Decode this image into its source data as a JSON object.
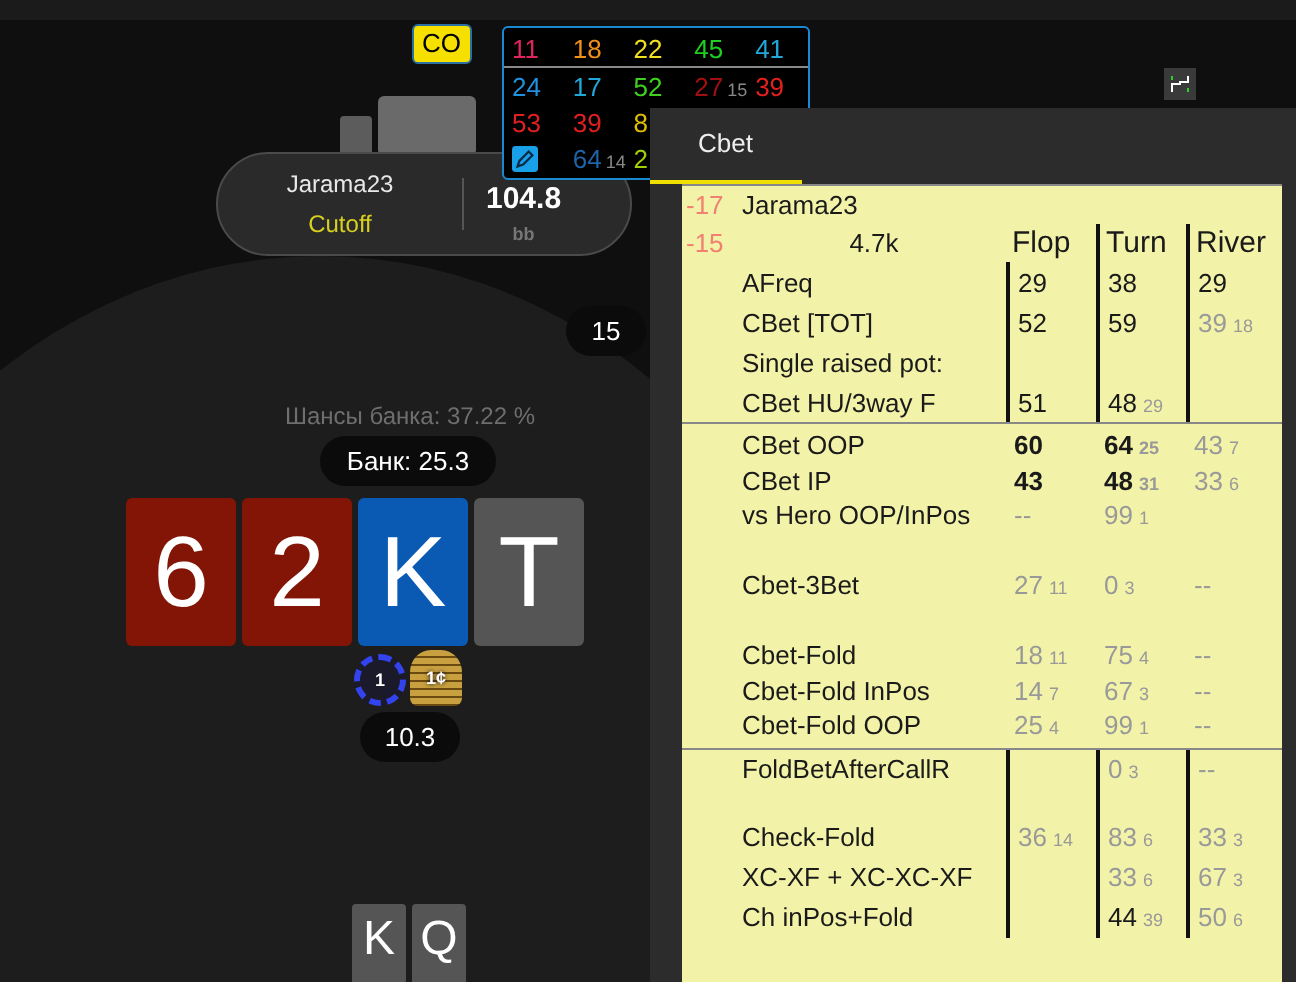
{
  "hud": {
    "rows": [
      [
        {
          "kind": "stat",
          "text": "11",
          "color": "#e0245e"
        },
        {
          "kind": "stat",
          "text": "18",
          "color": "#f0901a"
        },
        {
          "kind": "stat",
          "text": "22",
          "color": "#f0e020"
        },
        {
          "kind": "stat",
          "text": "45",
          "color": "#20d020"
        },
        {
          "kind": "stat",
          "text": "41",
          "color": "#20a8d8"
        }
      ],
      [
        {
          "kind": "stat",
          "text": "24",
          "color": "#2090e0"
        },
        {
          "kind": "stat",
          "text": "17",
          "color": "#20a8d8"
        },
        {
          "kind": "stat",
          "text": "52",
          "color": "#40d020"
        },
        {
          "kind": "stat",
          "text": "27",
          "sub": "15",
          "color": "#a01010"
        },
        {
          "kind": "stat",
          "text": "39",
          "color": "#e02020"
        }
      ],
      [
        {
          "kind": "stat",
          "text": "53",
          "color": "#e02020"
        },
        {
          "kind": "stat",
          "text": "39",
          "color": "#e02020"
        },
        {
          "kind": "stat",
          "text": "8",
          "color": "#e0c000"
        }
      ],
      [
        {
          "kind": "edit"
        },
        {
          "kind": "stat",
          "text": "64",
          "sub": "14",
          "color": "#1f63a8"
        },
        {
          "kind": "stat",
          "text": "2",
          "color": "#a0d000"
        }
      ]
    ]
  },
  "seat": {
    "badge": "CO",
    "name": "Jarama23",
    "position": "Cutoff",
    "stack": "104.8",
    "unit": "bb",
    "bet": "15"
  },
  "pot": {
    "odds": "Шансы банка: 37.22 %",
    "total": "Банк: 25.3",
    "chips": [
      {
        "label": "1",
        "kind": "round"
      },
      {
        "label": "1¢",
        "kind": "stack"
      }
    ],
    "amount": "10.3"
  },
  "board": [
    {
      "rank": "6",
      "color": "#831507"
    },
    {
      "rank": "2",
      "color": "#831507"
    },
    {
      "rank": "K",
      "color": "#0a5ab4"
    },
    {
      "rank": "T",
      "color": "#555555"
    }
  ],
  "hero_cards": [
    {
      "rank": "K"
    },
    {
      "rank": "Q"
    }
  ],
  "stats_panel": {
    "tabs": [
      {
        "label": "Cbet",
        "selected": true
      }
    ],
    "header": {
      "score_1": "-17",
      "player": "Jarama23",
      "score_2": "-15",
      "hands": "4.7k",
      "columns": [
        "Flop",
        "Turn",
        "River"
      ]
    },
    "sections": [
      {
        "kind": "lined",
        "rows": [
          {
            "kind": "stat",
            "label": "AFreq",
            "flop": {
              "v": "29",
              "bold": false,
              "muted": false
            },
            "turn": {
              "v": "38",
              "bold": false,
              "muted": false
            },
            "river": {
              "v": "29",
              "bold": false,
              "muted": false
            }
          },
          {
            "kind": "stat",
            "label": "CBet [TOT]",
            "flop": {
              "v": "52",
              "bold": false,
              "muted": false
            },
            "turn": {
              "v": "59",
              "bold": false,
              "muted": false
            },
            "river": {
              "v": "39",
              "n": "18",
              "bold": false,
              "muted": true
            }
          },
          {
            "kind": "stat",
            "label": "Single raised pot:"
          },
          {
            "kind": "stat",
            "label": "CBet HU/3way F",
            "flop": {
              "v": "51",
              "bold": false,
              "muted": false
            },
            "turn": {
              "v": "48",
              "n": "29",
              "bold": false,
              "muted": false
            }
          }
        ]
      },
      {
        "kind": "boxed",
        "rows": [
          {
            "kind": "stat",
            "label": "CBet OOP",
            "flop": {
              "v": "60",
              "bold": true,
              "muted": false
            },
            "turn": {
              "v": "64",
              "n": "25",
              "bold": true,
              "muted": false
            },
            "river": {
              "v": "43",
              "n": "7",
              "bold": false,
              "muted": true
            }
          },
          {
            "kind": "stat",
            "label": "CBet IP",
            "flop": {
              "v": "43",
              "bold": true,
              "muted": false
            },
            "turn": {
              "v": "48",
              "n": "31",
              "bold": true,
              "muted": false
            },
            "river": {
              "v": "33",
              "n": "6",
              "bold": false,
              "muted": true
            }
          },
          {
            "kind": "stat",
            "label": "vs Hero OOP/InPos",
            "flop": {
              "v": "--",
              "bold": false,
              "muted": true
            },
            "turn": {
              "v": "99",
              "n": "1",
              "bold": false,
              "muted": true
            }
          },
          {
            "kind": "gap"
          },
          {
            "kind": "stat",
            "label": "Cbet-3Bet",
            "flop": {
              "v": "27",
              "n": "11",
              "bold": false,
              "muted": true
            },
            "turn": {
              "v": "0",
              "n": "3",
              "bold": false,
              "muted": true
            },
            "river": {
              "v": "--",
              "bold": false,
              "muted": true
            }
          },
          {
            "kind": "gap"
          },
          {
            "kind": "stat",
            "label": "Cbet-Fold",
            "flop": {
              "v": "18",
              "n": "11",
              "bold": false,
              "muted": true
            },
            "turn": {
              "v": "75",
              "n": "4",
              "bold": false,
              "muted": true
            },
            "river": {
              "v": "--",
              "bold": false,
              "muted": true
            }
          },
          {
            "kind": "stat",
            "label": "Cbet-Fold InPos",
            "flop": {
              "v": "14",
              "n": "7",
              "bold": false,
              "muted": true
            },
            "turn": {
              "v": "67",
              "n": "3",
              "bold": false,
              "muted": true
            },
            "river": {
              "v": "--",
              "bold": false,
              "muted": true
            }
          },
          {
            "kind": "stat",
            "label": "Cbet-Fold OOP",
            "flop": {
              "v": "25",
              "n": "4",
              "bold": false,
              "muted": true
            },
            "turn": {
              "v": "99",
              "n": "1",
              "bold": false,
              "muted": true
            },
            "river": {
              "v": "--",
              "bold": false,
              "muted": true
            }
          }
        ]
      },
      {
        "kind": "lined",
        "rows": [
          {
            "kind": "stat",
            "label": "FoldBetAfterCallR",
            "turn": {
              "v": "0",
              "n": "3",
              "bold": false,
              "muted": true
            },
            "river": {
              "v": "--",
              "bold": false,
              "muted": true
            }
          },
          {
            "kind": "gap"
          },
          {
            "kind": "stat",
            "label": "Check-Fold",
            "flop": {
              "v": "36",
              "n": "14",
              "bold": false,
              "muted": true
            },
            "turn": {
              "v": "83",
              "n": "6",
              "bold": false,
              "muted": true
            },
            "river": {
              "v": "33",
              "n": "3",
              "bold": false,
              "muted": true
            }
          },
          {
            "kind": "stat",
            "label": "XC-XF + XC-XC-XF",
            "turn": {
              "v": "33",
              "n": "6",
              "bold": false,
              "muted": true
            },
            "river": {
              "v": "67",
              "n": "3",
              "bold": false,
              "muted": true
            }
          },
          {
            "kind": "stat",
            "label": "Ch inPos+Fold",
            "turn": {
              "v": "44",
              "n": "39",
              "bold": false,
              "muted": false
            },
            "river": {
              "v": "50",
              "n": "6",
              "bold": false,
              "muted": true
            }
          }
        ]
      }
    ]
  }
}
